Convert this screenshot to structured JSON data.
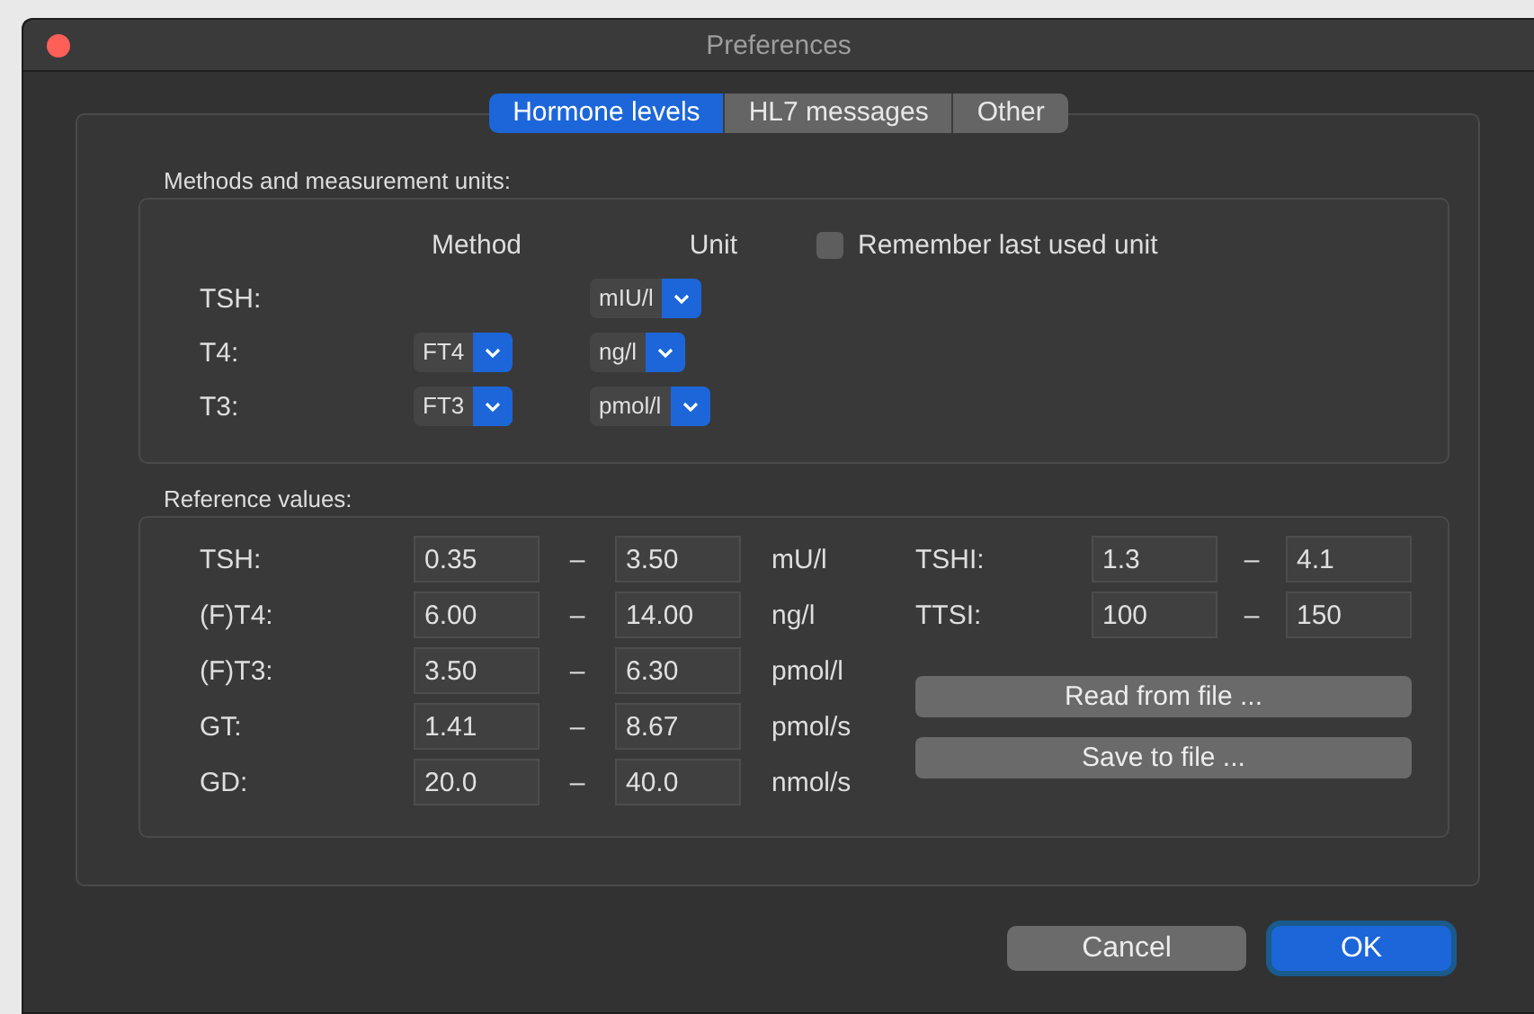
{
  "window": {
    "title": "Preferences"
  },
  "tabs": [
    {
      "label": "Hormone levels",
      "selected": true
    },
    {
      "label": "HL7 messages",
      "selected": false
    },
    {
      "label": "Other",
      "selected": false
    }
  ],
  "methods": {
    "title": "Methods and measurement units:",
    "method_header": "Method",
    "unit_header": "Unit",
    "remember": {
      "label": "Remember last used unit",
      "checked": false
    },
    "rows": [
      {
        "label": "TSH:",
        "unit": "mIU/l"
      },
      {
        "label": "T4:",
        "method": "FT4",
        "unit": "ng/l"
      },
      {
        "label": "T3:",
        "method": "FT3",
        "unit": "pmol/l"
      }
    ]
  },
  "reference": {
    "title": "Reference values:",
    "rows": [
      {
        "label": "TSH:",
        "low": "0.35",
        "dash": "–",
        "high": "3.50",
        "unit": "mU/l"
      },
      {
        "label": "(F)T4:",
        "low": "6.00",
        "dash": "–",
        "high": "14.00",
        "unit": "ng/l"
      },
      {
        "label": "(F)T3:",
        "low": "3.50",
        "dash": "–",
        "high": "6.30",
        "unit": "pmol/l"
      },
      {
        "label": "GT:",
        "low": "1.41",
        "dash": "–",
        "high": "8.67",
        "unit": "pmol/s"
      },
      {
        "label": "GD:",
        "low": "20.0",
        "dash": "–",
        "high": "40.0",
        "unit": "nmol/s"
      }
    ],
    "antibodies": [
      {
        "label": "TSHI:",
        "low": "1.3",
        "dash": "–",
        "high": "4.1"
      },
      {
        "label": "TTSI:",
        "low": "100",
        "dash": "–",
        "high": "150"
      }
    ],
    "file_buttons": [
      "Read from file ...",
      "Save to file ..."
    ]
  },
  "buttons": [
    {
      "label": "Cancel",
      "kind": "normal"
    },
    {
      "label": "OK",
      "kind": "default"
    }
  ]
}
